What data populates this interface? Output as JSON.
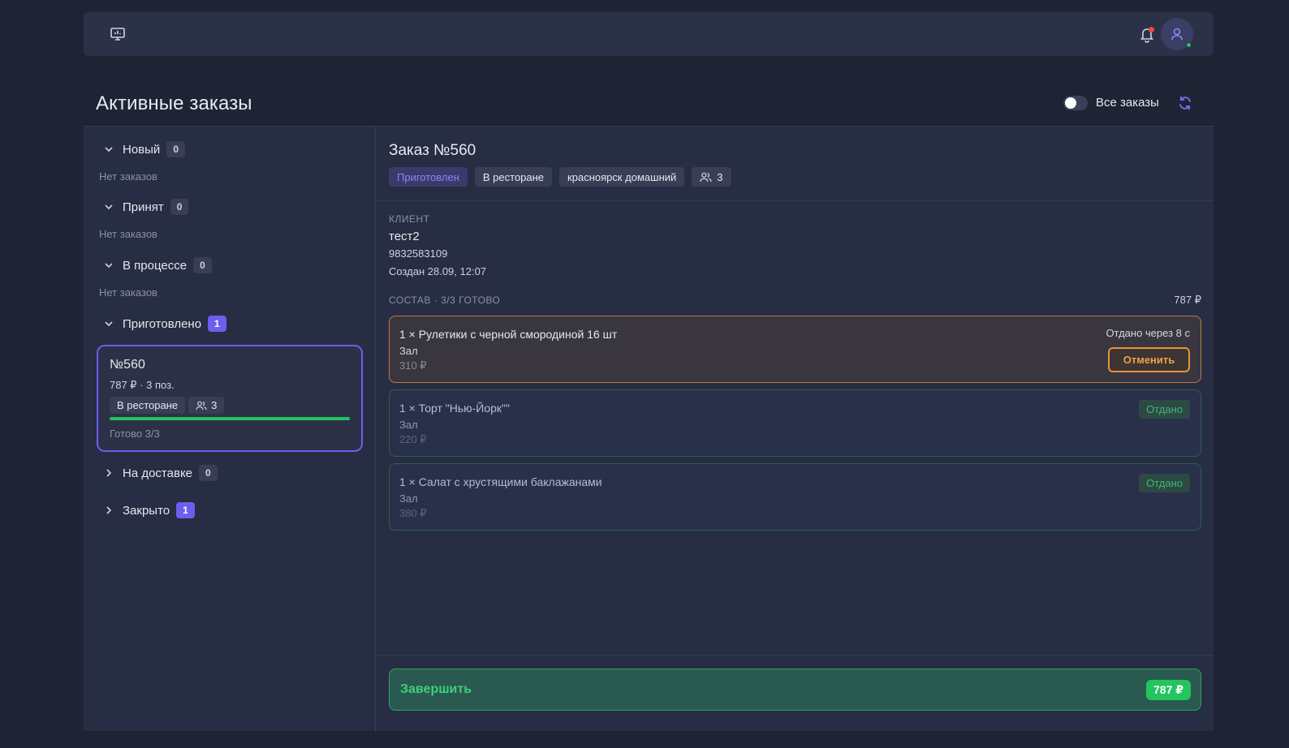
{
  "header": {
    "monitor_icon": "monitor-icon",
    "bell_icon": "bell-icon",
    "avatar_icon": "user-icon"
  },
  "page": {
    "title": "Активные заказы",
    "toggle_label": "Все заказы",
    "toggle_on": false
  },
  "groups": [
    {
      "label": "Новый",
      "count": "0",
      "empty": "Нет заказов",
      "expanded": true
    },
    {
      "label": "Принят",
      "count": "0",
      "empty": "Нет заказов",
      "expanded": true
    },
    {
      "label": "В процессе",
      "count": "0",
      "empty": "Нет заказов",
      "expanded": true
    },
    {
      "label": "Приготовлено",
      "count": "1",
      "expanded": true
    },
    {
      "label": "На доставке",
      "count": "0",
      "expanded": false
    },
    {
      "label": "Закрыто",
      "count": "1",
      "expanded": false
    }
  ],
  "order_card": {
    "number": "№560",
    "summary": "787 ₽ · 3 поз.",
    "type_tag": "В ресторане",
    "guests": "3",
    "progress": 1.0,
    "ready": "Готово 3/3"
  },
  "order": {
    "title": "Заказ №560",
    "status": "Приготовлен",
    "type": "В ресторане",
    "location": "красноярск домашний",
    "guests": "3",
    "client_caption": "КЛИЕНТ",
    "client_name": "тест2",
    "client_phone": "9832583109",
    "created": "Создан 28.09, 12:07",
    "composition_caption": "СОСТАВ · 3/3 ГОТОВО",
    "composition_sum": "787 ₽",
    "items": [
      {
        "name": "1 × Рулетики с черной смородиной 16 шт",
        "place": "Зал",
        "price": "310 ₽",
        "timer": "Отдано через 8 с",
        "action": "Отменить"
      },
      {
        "name": "1 × Торт \"Нью-Йорк\"\"",
        "place": "Зал",
        "price": "220 ₽",
        "status": "Отдано"
      },
      {
        "name": "1 × Салат с хрустящими баклажанами",
        "place": "Зал",
        "price": "380 ₽",
        "status": "Отдано"
      }
    ],
    "finish_label": "Завершить",
    "finish_sum": "787 ₽"
  },
  "colors": {
    "accent": "#6d5ef0",
    "success": "#22c55e",
    "warning": "#e8913a",
    "background": "#1f2435"
  }
}
